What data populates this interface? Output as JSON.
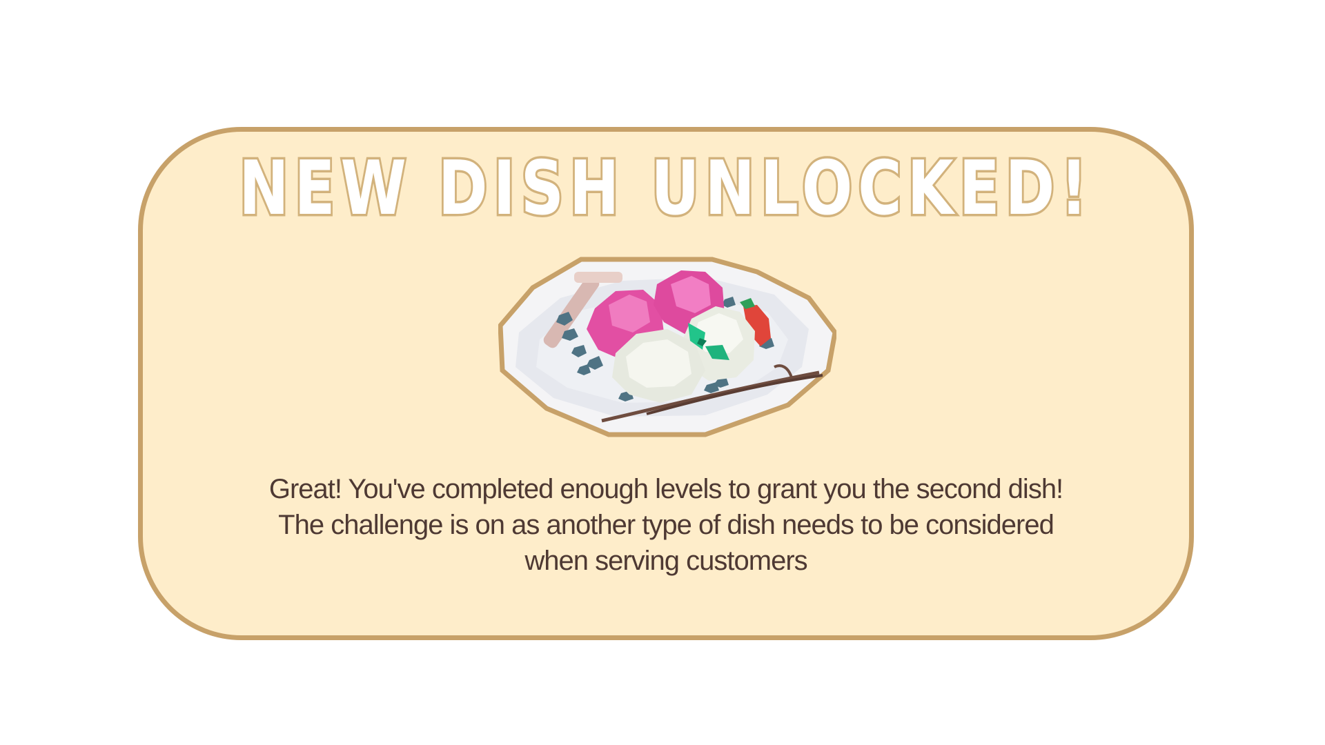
{
  "popup": {
    "title": "NEW DISH UNLOCKED!",
    "dish_icon": "ice-cream-plate-icon",
    "message_lines": [
      "Great! You've completed enough levels to grant you the second dish!",
      "The challenge is on as another type of dish needs to be considered",
      "when serving customers"
    ]
  },
  "colors": {
    "panel_background": "#feedca",
    "panel_border": "#c7a169",
    "title_fill": "#ffffff",
    "title_outline": "#d2b27c",
    "text": "#4e3933"
  }
}
